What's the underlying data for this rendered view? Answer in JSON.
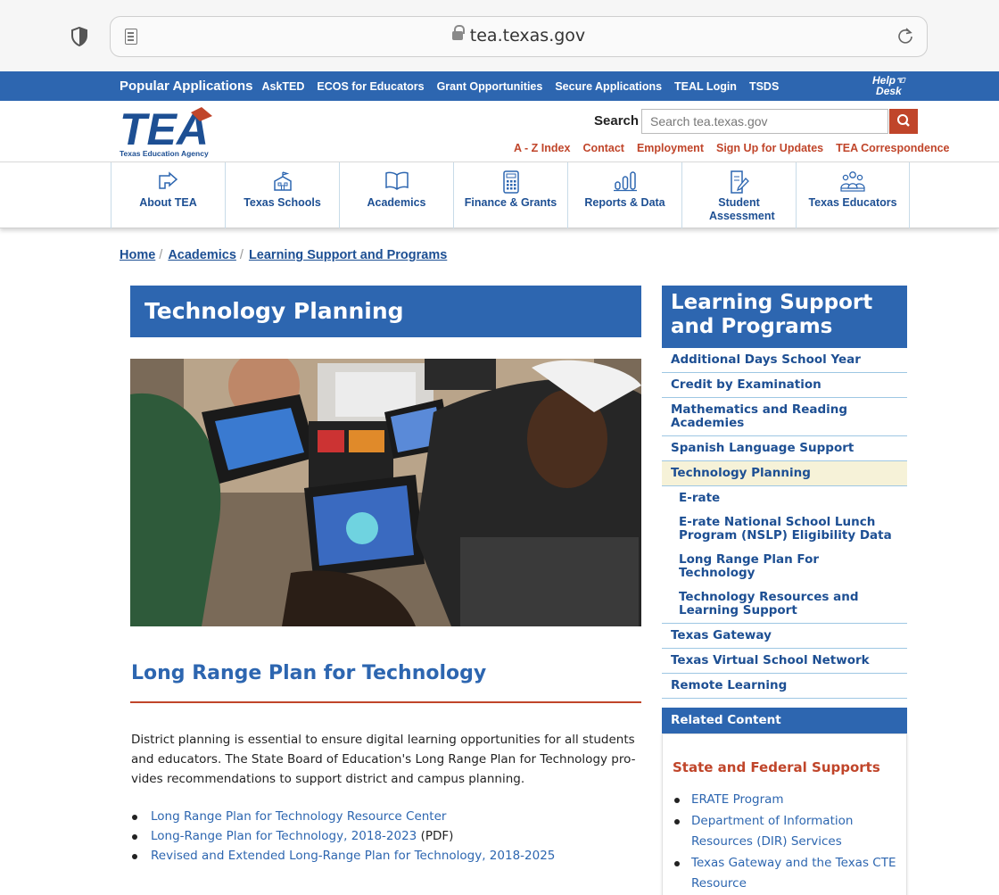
{
  "browser": {
    "url": "tea.texas.gov"
  },
  "topbar": {
    "links": [
      "Popular Applications",
      "AskTED",
      "ECOS for Educators",
      "Grant Opportunities",
      "Secure Applications",
      "TEAL Login",
      "TSDS"
    ],
    "helpdesk_line1": "Help",
    "helpdesk_line2": "Desk"
  },
  "header": {
    "logo_text": "TEA",
    "logo_subtitle": "Texas Education Agency",
    "search_label": "Search",
    "search_placeholder": "Search tea.texas.gov",
    "utility_links": [
      "A - Z Index",
      "Contact",
      "Employment",
      "Sign Up for Updates",
      "TEA Correspondence"
    ]
  },
  "mainnav": [
    {
      "label": "About TEA",
      "icon": "hand-pointer-icon"
    },
    {
      "label": "Texas Schools",
      "icon": "school-building-icon"
    },
    {
      "label": "Academics",
      "icon": "open-book-icon"
    },
    {
      "label": "Finance & Grants",
      "icon": "calculator-icon"
    },
    {
      "label": "Reports & Data",
      "icon": "bar-chart-icon"
    },
    {
      "label": "Student Assessment",
      "icon": "document-edit-icon"
    },
    {
      "label": "Texas Educators",
      "icon": "educators-group-icon"
    }
  ],
  "breadcrumb": [
    "Home",
    "Academics",
    "Learning Support and Programs"
  ],
  "main": {
    "title": "Technology Planning",
    "section_heading": "Long Range Plan for Technology",
    "body": "District planning is essential to ensure digital learning opportunities for all students and educators. The State Board of Education's Long Range Plan for Technology pro-vides recommendations to support district and campus planning.",
    "links": [
      {
        "text": "Long Range Plan for Technology Resource Center",
        "suffix": ""
      },
      {
        "text": "Long-Range Plan for Technology, 2018-2023",
        "suffix": " (PDF)"
      },
      {
        "text": "Revised and Extended Long-Range Plan for Technology, 2018-2025",
        "suffix": ""
      }
    ]
  },
  "sidebar": {
    "title": "Learning Support and Programs",
    "items": [
      {
        "label": "Additional Days School Year",
        "type": "item"
      },
      {
        "label": "Credit by Examination",
        "type": "item"
      },
      {
        "label": "Mathematics and Reading Academies",
        "type": "item"
      },
      {
        "label": "Spanish Language Support",
        "type": "item"
      },
      {
        "label": "Technology Planning",
        "type": "active"
      },
      {
        "label": "E-rate",
        "type": "sub"
      },
      {
        "label": "E-rate National School Lunch Program (NSLP) Eligibility Data",
        "type": "sub"
      },
      {
        "label": "Long Range Plan For Technology",
        "type": "sub"
      },
      {
        "label": "Technology Resources and Learning Support",
        "type": "sub-last"
      },
      {
        "label": "Texas Gateway",
        "type": "item"
      },
      {
        "label": "Texas Virtual School Network",
        "type": "item"
      },
      {
        "label": "Remote Learning",
        "type": "item"
      }
    ],
    "related_heading": "Related Content",
    "related_subheading": "State and Federal Supports",
    "related_links": [
      "ERATE Program",
      "Department of Information Resources (DIR) Services",
      "Texas Gateway and the Texas CTE Resource"
    ]
  },
  "colors": {
    "brand_blue": "#2d66b0",
    "accent_red": "#c0452a",
    "nav_text": "#1d4f93",
    "active_bg": "#f6f2d8"
  }
}
